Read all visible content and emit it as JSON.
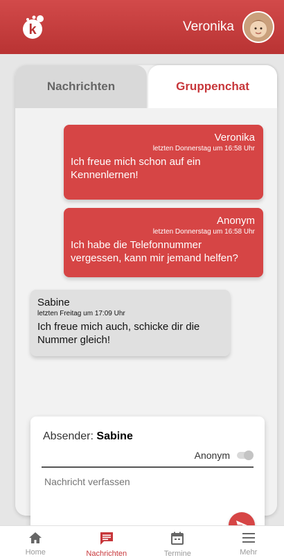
{
  "header": {
    "user_name": "Veronika"
  },
  "tabs": [
    {
      "label": "Nachrichten",
      "active": false
    },
    {
      "label": "Gruppenchat",
      "active": true
    }
  ],
  "messages": [
    {
      "sender": "Veronika",
      "time": "letzten Donnerstag um 16:58 Uhr",
      "text": "Ich freue mich schon auf ein Kennenlernen!",
      "own": true
    },
    {
      "sender": "Anonym",
      "time": "letzten Donnerstag um 16:58 Uhr",
      "text": "Ich habe die Telefonnummer vergessen,  kann mir jemand helfen?",
      "own": true
    },
    {
      "sender": "Sabine",
      "time": "letzten Freitag um 17:09 Uhr",
      "text": "Ich freue mich auch, schicke dir die Nummer gleich!",
      "own": false
    }
  ],
  "composer": {
    "sender_label": "Absender:",
    "sender_name": "Sabine",
    "anonymous_label": "Anonym",
    "placeholder": "Nachricht verfassen"
  },
  "nav": [
    {
      "label": "Home",
      "icon": "home-icon",
      "active": false
    },
    {
      "label": "Nachrichten",
      "icon": "message-icon",
      "active": true
    },
    {
      "label": "Termine",
      "icon": "calendar-icon",
      "active": false
    },
    {
      "label": "Mehr",
      "icon": "menu-icon",
      "active": false
    }
  ],
  "colors": {
    "accent": "#c7363a",
    "bubble_own": "#d64545",
    "bubble_other": "#e0e0e0"
  }
}
